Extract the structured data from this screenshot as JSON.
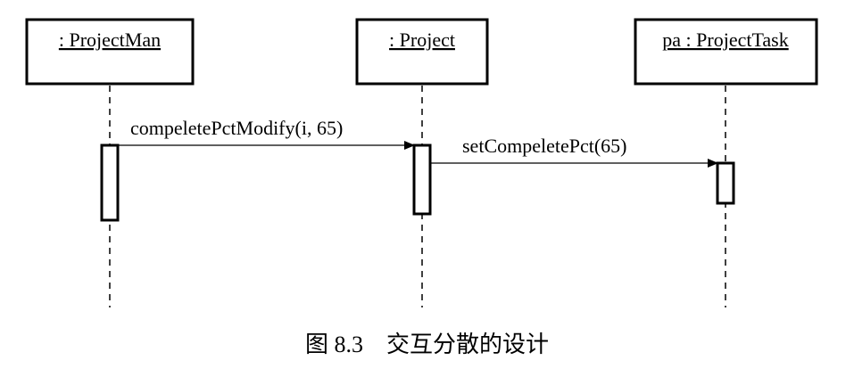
{
  "diagram": {
    "type": "sequence",
    "objects": [
      {
        "id": "pm",
        "label": ": ProjectMan"
      },
      {
        "id": "p",
        "label": ": Project"
      },
      {
        "id": "pt",
        "label": "pa : ProjectTask"
      }
    ],
    "messages": [
      {
        "from": "pm",
        "to": "p",
        "label": "compeletePctModify(i, 65)"
      },
      {
        "from": "p",
        "to": "pt",
        "label": "setCompeletePct(65)"
      }
    ]
  },
  "caption": "图 8.3    交互分散的设计"
}
